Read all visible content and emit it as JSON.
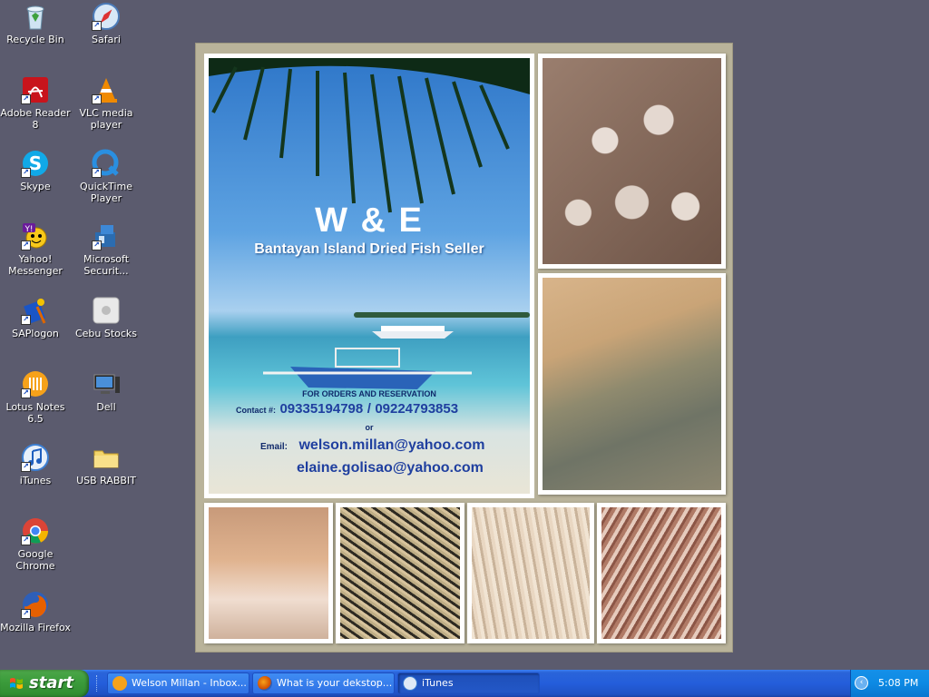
{
  "desktop": {
    "icons": [
      {
        "label": "Recycle Bin",
        "icon": "recycle-bin-icon"
      },
      {
        "label": "Safari",
        "icon": "safari-icon"
      },
      {
        "label": "Adobe Reader 8",
        "icon": "adobe-reader-icon"
      },
      {
        "label": "VLC media player",
        "icon": "vlc-icon"
      },
      {
        "label": "Skype",
        "icon": "skype-icon"
      },
      {
        "label": "QuickTime Player",
        "icon": "quicktime-icon"
      },
      {
        "label": "Yahoo! Messenger",
        "icon": "yahoo-messenger-icon"
      },
      {
        "label": "Microsoft Securit...",
        "icon": "microsoft-security-icon"
      },
      {
        "label": "SAPlogon",
        "icon": "saplogon-icon"
      },
      {
        "label": "Cebu Stocks",
        "icon": "cebu-stocks-icon"
      },
      {
        "label": "Lotus Notes 6.5",
        "icon": "lotus-notes-icon"
      },
      {
        "label": "Dell",
        "icon": "dell-icon"
      },
      {
        "label": "iTunes",
        "icon": "itunes-icon"
      },
      {
        "label": "USB RABBIT",
        "icon": "folder-icon"
      },
      {
        "label": "Google Chrome",
        "icon": "chrome-icon"
      },
      {
        "label": "Mozilla Firefox",
        "icon": "firefox-icon"
      }
    ]
  },
  "wallpaper": {
    "title": "W & E",
    "subtitle": "Bantayan Island Dried Fish Seller",
    "orders": "FOR ORDERS AND RESERVATION",
    "contact_label": "Contact #:",
    "phone1": "09335194798",
    "phone_sep": "/",
    "phone2": "09224793853",
    "or": "or",
    "email_label": "Email:",
    "email1": "welson.millan@yahoo.com",
    "email2": "elaine.golisao@yahoo.com",
    "text_color": "#1f3f9f"
  },
  "taskbar": {
    "start_label": "start",
    "tasks": [
      {
        "label": "Welson Millan - Inbox...",
        "icon": "lotus-notes-icon"
      },
      {
        "label": "What is your dekstop...",
        "icon": "firefox-icon"
      },
      {
        "label": "iTunes",
        "icon": "itunes-icon"
      }
    ],
    "clock": "5:08 PM"
  },
  "colors": {
    "desktop_bg": "#5b5b6e",
    "taskbar_blue": "#245edb",
    "start_green": "#3c9d3c"
  }
}
